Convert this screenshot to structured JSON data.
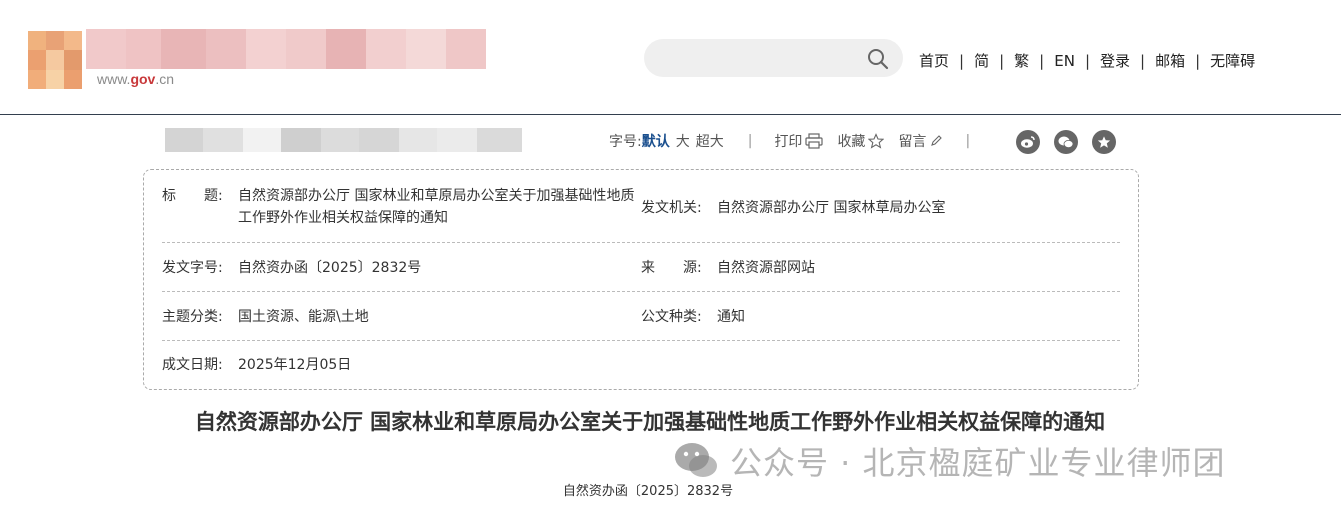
{
  "header": {
    "domain_prefix": "www.",
    "domain_brand": "gov",
    "domain_suffix": ".cn",
    "search": {
      "placeholder": ""
    },
    "nav": [
      {
        "label": "首页"
      },
      {
        "label": "简"
      },
      {
        "label": "繁"
      },
      {
        "label": "EN"
      },
      {
        "label": "登录"
      },
      {
        "label": "邮箱"
      },
      {
        "label": "无障碍"
      }
    ],
    "separator": "|"
  },
  "toolbar": {
    "font_size_label": "字号:",
    "sizes": [
      {
        "label": "默认",
        "active": true
      },
      {
        "label": "大",
        "active": false
      },
      {
        "label": "超大",
        "active": false
      }
    ],
    "separator": "|",
    "print_label": "打印",
    "favorite_label": "收藏",
    "comment_label": "留言"
  },
  "info": {
    "title_key": "标　　题:",
    "title_value": "自然资源部办公厅 国家林业和草原局办公室关于加强基础性地质工作野外作业相关权益保障的通知",
    "issuer_key": "发文机关:",
    "issuer_value": "自然资源部办公厅 国家林草局办公室",
    "docno_key": "发文字号:",
    "docno_value": "自然资办函〔2025〕2832号",
    "source_key": "来　　源:",
    "source_value": "自然资源部网站",
    "topic_key": "主题分类:",
    "topic_value": "国土资源、能源\\土地",
    "type_key": "公文种类:",
    "type_value": "通知",
    "date_key": "成文日期:",
    "date_value": "2025年12月05日"
  },
  "article": {
    "title": "自然资源部办公厅 国家林业和草原局办公室关于加强基础性地质工作野外作业相关权益保障的通知",
    "doc_number": "自然资办函〔2025〕2832号"
  },
  "watermark": {
    "text": "公众号 · 北京楹庭矿业专业律师团"
  },
  "colors": {
    "header_rule": "#333f4e",
    "active_font_size": "#1a4f8e",
    "brand_red": "#c8383a"
  }
}
